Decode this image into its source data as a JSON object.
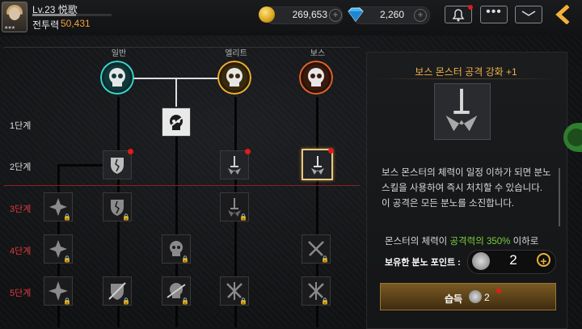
{
  "player": {
    "level_name": "Lv.23 悦歌",
    "xp_progress": 0.55,
    "power_label": "전투력",
    "power_value": "50,431"
  },
  "currency": {
    "gold": "269,653",
    "gems": "2,260",
    "plus_symbol": "+"
  },
  "top_buttons": {
    "more_label": "•••"
  },
  "tree": {
    "columns": [
      "일반",
      "엘리트",
      "보스"
    ],
    "rows": [
      "1단계",
      "2단계",
      "3단계",
      "4단계",
      "5단계"
    ],
    "lock_glyph": "🔒"
  },
  "detail": {
    "title": "보스 몬스터 공격 강화 +1",
    "description_1": "보스 몬스터의 체력이 일정 이하가 되면 분노 스킬을 사용하여 즉시 처치할 수 있습니다.",
    "description_2": " 이 공격은 모든 분노를 소진합니다.",
    "condition_prefix": "몬스터의 체력이 ",
    "condition_highlight": "공격력의 350%",
    "condition_suffix": " 이하로",
    "points_label": "보유한 분노 포인트 :",
    "points_value": "2",
    "learn_label": "습득",
    "learn_cost": "2"
  },
  "colors": {
    "accent_gold": "#f0b247",
    "highlight_green": "#79cf3a",
    "row_red": "#e03a3a",
    "notify_red": "#e21b1b"
  }
}
